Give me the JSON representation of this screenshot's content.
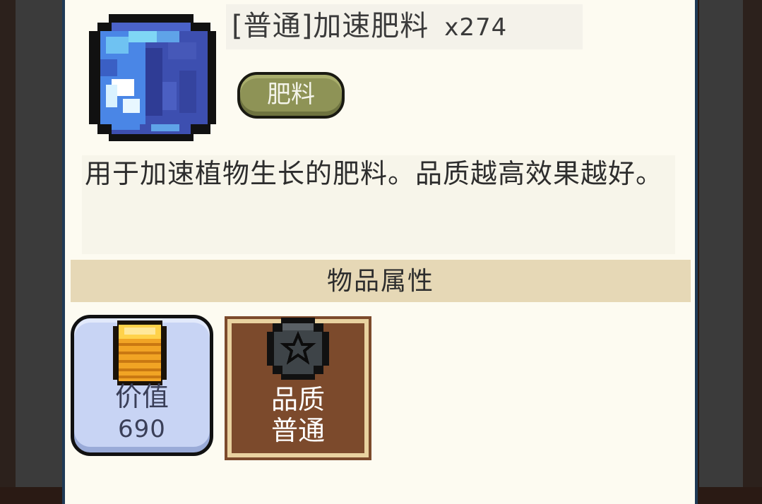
{
  "item": {
    "title": "[普通]加速肥料",
    "count": "x274",
    "icon": "fertilizer-crystal-icon"
  },
  "tag": {
    "label": "肥料",
    "color": "#8e9356"
  },
  "description": "用于加速植物生长的肥料。品质越高效果越好。",
  "section": {
    "title": "物品属性"
  },
  "attributes": {
    "value": {
      "label": "价值",
      "amount": "690",
      "icon": "coin-stack-icon",
      "color": "#c8d4f4"
    },
    "quality": {
      "label": "品质",
      "value": "普通",
      "icon": "quality-star-badge-icon",
      "color": "#7c4a2c"
    }
  }
}
